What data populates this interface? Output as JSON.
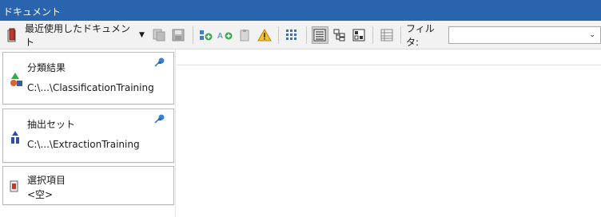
{
  "window": {
    "title": "ドキュメント"
  },
  "toolbar": {
    "recent_label": "最近使用したドキュメント",
    "filter_label": "フィルタ:",
    "filter_value": "",
    "icons": [
      "document-delete-icon",
      "copy-icon",
      "save-icon",
      "add-green-icon",
      "add-object-icon",
      "clipboard-icon",
      "warning-icon",
      "grid-icon",
      "list-view-icon",
      "tree-view-icon",
      "tile-view-icon",
      "table-view-icon"
    ],
    "colors": {
      "titlebar": "#2b64ae",
      "toolbar_bg": "#f2f2f2"
    }
  },
  "documents": [
    {
      "name": "分類結果",
      "path": "C:\\...\\ClassificationTraining",
      "icon": "classification-icon",
      "pinned": true
    },
    {
      "name": "抽出セット",
      "path": "C:\\...\\ExtractionTraining",
      "icon": "extraction-icon",
      "pinned": true
    },
    {
      "name": "選択項目",
      "path": "<空>",
      "icon": "selection-icon",
      "pinned": false
    }
  ]
}
